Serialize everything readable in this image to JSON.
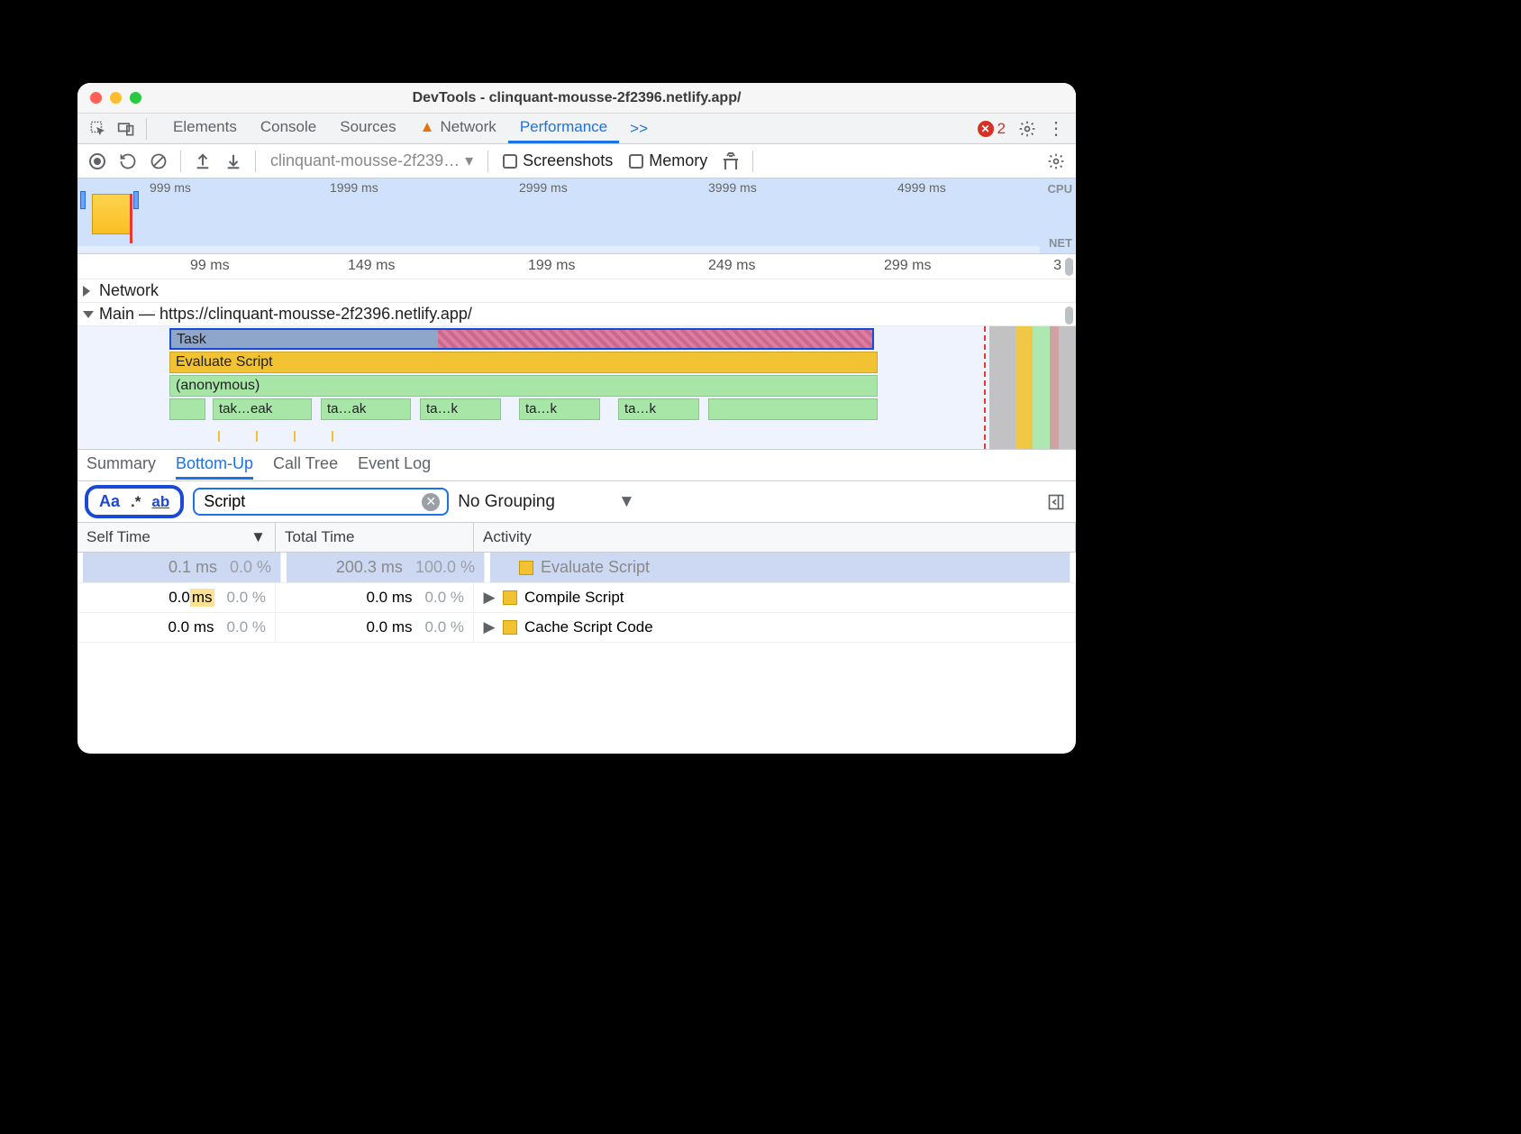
{
  "window": {
    "title": "DevTools - clinquant-mousse-2f2396.netlify.app/"
  },
  "tabs": {
    "elements": "Elements",
    "console": "Console",
    "sources": "Sources",
    "network": "Network",
    "performance": "Performance",
    "more": ">>",
    "error_count": "2"
  },
  "toolbar": {
    "profile_selector": "clinquant-mousse-2f239…",
    "screenshots": "Screenshots",
    "memory": "Memory"
  },
  "overview": {
    "ticks": [
      "999 ms",
      "1999 ms",
      "2999 ms",
      "3999 ms",
      "4999 ms"
    ],
    "labels": [
      "CPU",
      "NET"
    ]
  },
  "ruler": {
    "ticks": [
      "99 ms",
      "149 ms",
      "199 ms",
      "249 ms",
      "299 ms",
      "3"
    ]
  },
  "tracks": {
    "network": "Network",
    "main": "Main — https://clinquant-mousse-2f2396.netlify.app/"
  },
  "flame": {
    "task": "Task",
    "eval": "Evaluate Script",
    "anon": "(anonymous)",
    "leaves": [
      "tak…eak",
      "ta…ak",
      "ta…k",
      "ta…k",
      "ta…k"
    ]
  },
  "detail_tabs": {
    "summary": "Summary",
    "bottom_up": "Bottom-Up",
    "call_tree": "Call Tree",
    "event_log": "Event Log"
  },
  "filter": {
    "aa": "Aa",
    "regex": ".*",
    "whole": "ab",
    "value": "Script",
    "grouping": "No Grouping"
  },
  "table": {
    "headers": {
      "self": "Self Time",
      "total": "Total Time",
      "activity": "Activity"
    },
    "rows": [
      {
        "self_ms": "0.1 ms",
        "self_pct": "0.0 %",
        "total_ms": "200.3 ms",
        "total_pct": "100.0 %",
        "activity": "Evaluate Script",
        "expandable": false,
        "selected": true,
        "ms_hl": false
      },
      {
        "self_ms": "0.0 ms",
        "self_pct": "0.0 %",
        "total_ms": "0.0 ms",
        "total_pct": "0.0 %",
        "activity": "Compile Script",
        "expandable": true,
        "selected": false,
        "ms_hl": true
      },
      {
        "self_ms": "0.0 ms",
        "self_pct": "0.0 %",
        "total_ms": "0.0 ms",
        "total_pct": "0.0 %",
        "activity": "Cache Script Code",
        "expandable": true,
        "selected": false,
        "ms_hl": false
      }
    ]
  }
}
